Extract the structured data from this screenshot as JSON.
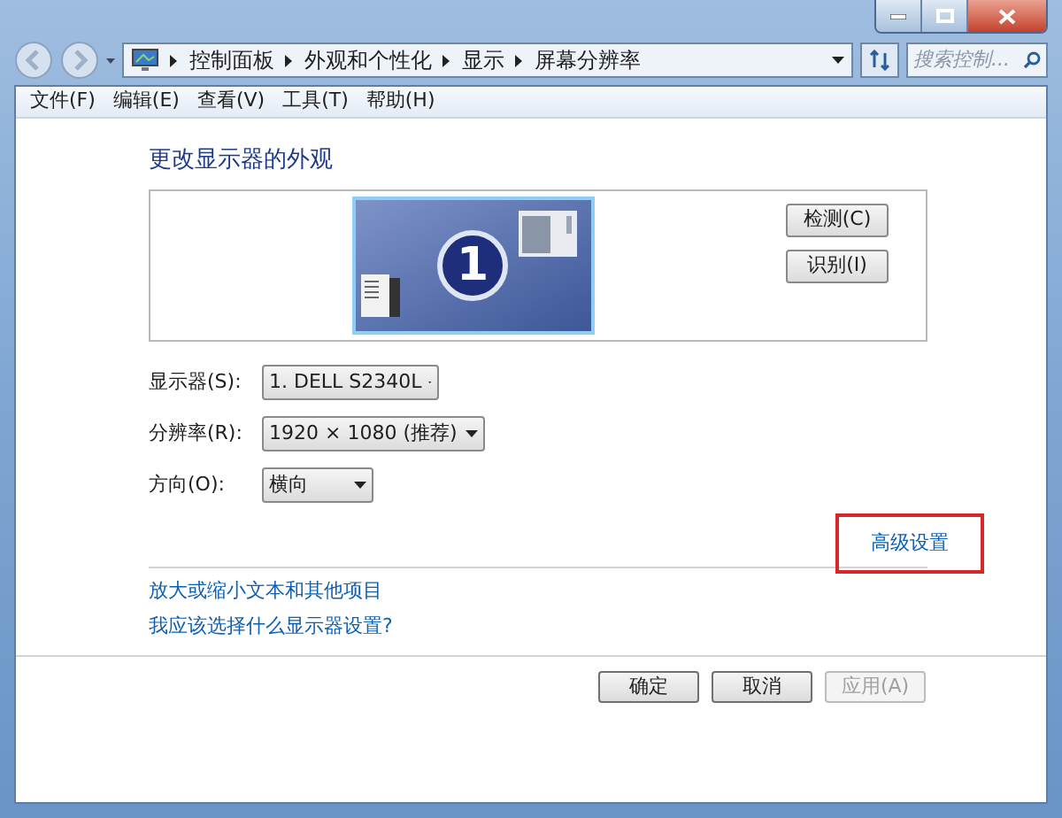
{
  "address_bar": {
    "breadcrumbs": [
      "控制面板",
      "外观和个性化",
      "显示",
      "屏幕分辨率"
    ]
  },
  "search": {
    "placeholder": "搜索控制..."
  },
  "menu": [
    "文件(F)",
    "编辑(E)",
    "查看(V)",
    "工具(T)",
    "帮助(H)"
  ],
  "heading": "更改显示器的外观",
  "preview": {
    "monitor_number": "1"
  },
  "side_buttons": [
    "检测(C)",
    "识别(I)"
  ],
  "settings": [
    {
      "label": "显示器(S):",
      "value": "1. DELL S2340L"
    },
    {
      "label": "分辨率(R):",
      "value": "1920 × 1080 (推荐)"
    },
    {
      "label": "方向(O):",
      "value": "横向"
    }
  ],
  "advanced_link": {
    "label": "高级设置",
    "highlighted": true
  },
  "links": [
    "放大或缩小文本和其他项目",
    "我应该选择什么显示器设置?"
  ],
  "buttons": [
    {
      "label": "确定",
      "disabled": false
    },
    {
      "label": "取消",
      "disabled": false
    },
    {
      "label": "应用(A)",
      "disabled": true
    }
  ]
}
